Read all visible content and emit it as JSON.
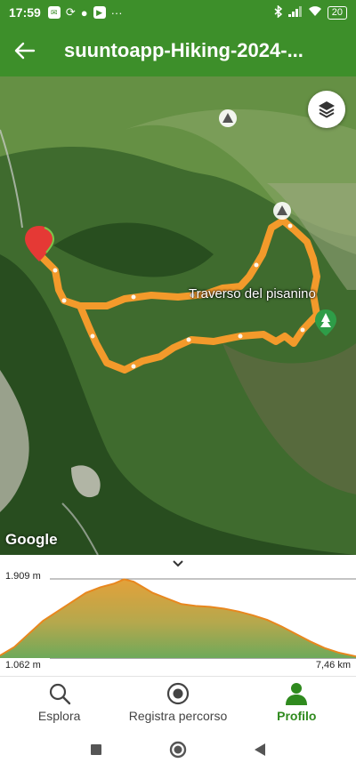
{
  "status_bar": {
    "time": "17:59",
    "battery": "20",
    "more": "···"
  },
  "app_bar": {
    "title": "suuntoapp-Hiking-2024-..."
  },
  "map": {
    "poi_label": "Traverso del pisanino",
    "attribution": "Google",
    "route_color": "#f39a2b",
    "start_marker_color": "#e53935",
    "end_marker_color": "#2e9d48"
  },
  "elevation": {
    "max_label": "1.909 m",
    "min_label": "1.062 m",
    "distance_label": "7,46 km",
    "chart_data": {
      "type": "area",
      "x_max_km": 7.46,
      "y_min_m": 1062,
      "y_max_m": 1909,
      "x": [
        0,
        0.3,
        0.6,
        0.9,
        1.2,
        1.5,
        1.8,
        2.1,
        2.4,
        2.6,
        2.8,
        3.0,
        3.2,
        3.5,
        3.8,
        4.1,
        4.4,
        4.7,
        5.0,
        5.3,
        5.6,
        5.9,
        6.2,
        6.5,
        6.8,
        7.1,
        7.46
      ],
      "y": [
        1090,
        1180,
        1320,
        1460,
        1560,
        1660,
        1760,
        1820,
        1860,
        1905,
        1880,
        1820,
        1760,
        1700,
        1640,
        1620,
        1610,
        1590,
        1560,
        1520,
        1470,
        1400,
        1320,
        1240,
        1170,
        1120,
        1080
      ]
    }
  },
  "bottom_nav": {
    "items": [
      {
        "label": "Esplora",
        "icon": "search-icon"
      },
      {
        "label": "Registra percorso",
        "icon": "record-icon"
      },
      {
        "label": "Profilo",
        "icon": "profile-icon"
      }
    ]
  }
}
